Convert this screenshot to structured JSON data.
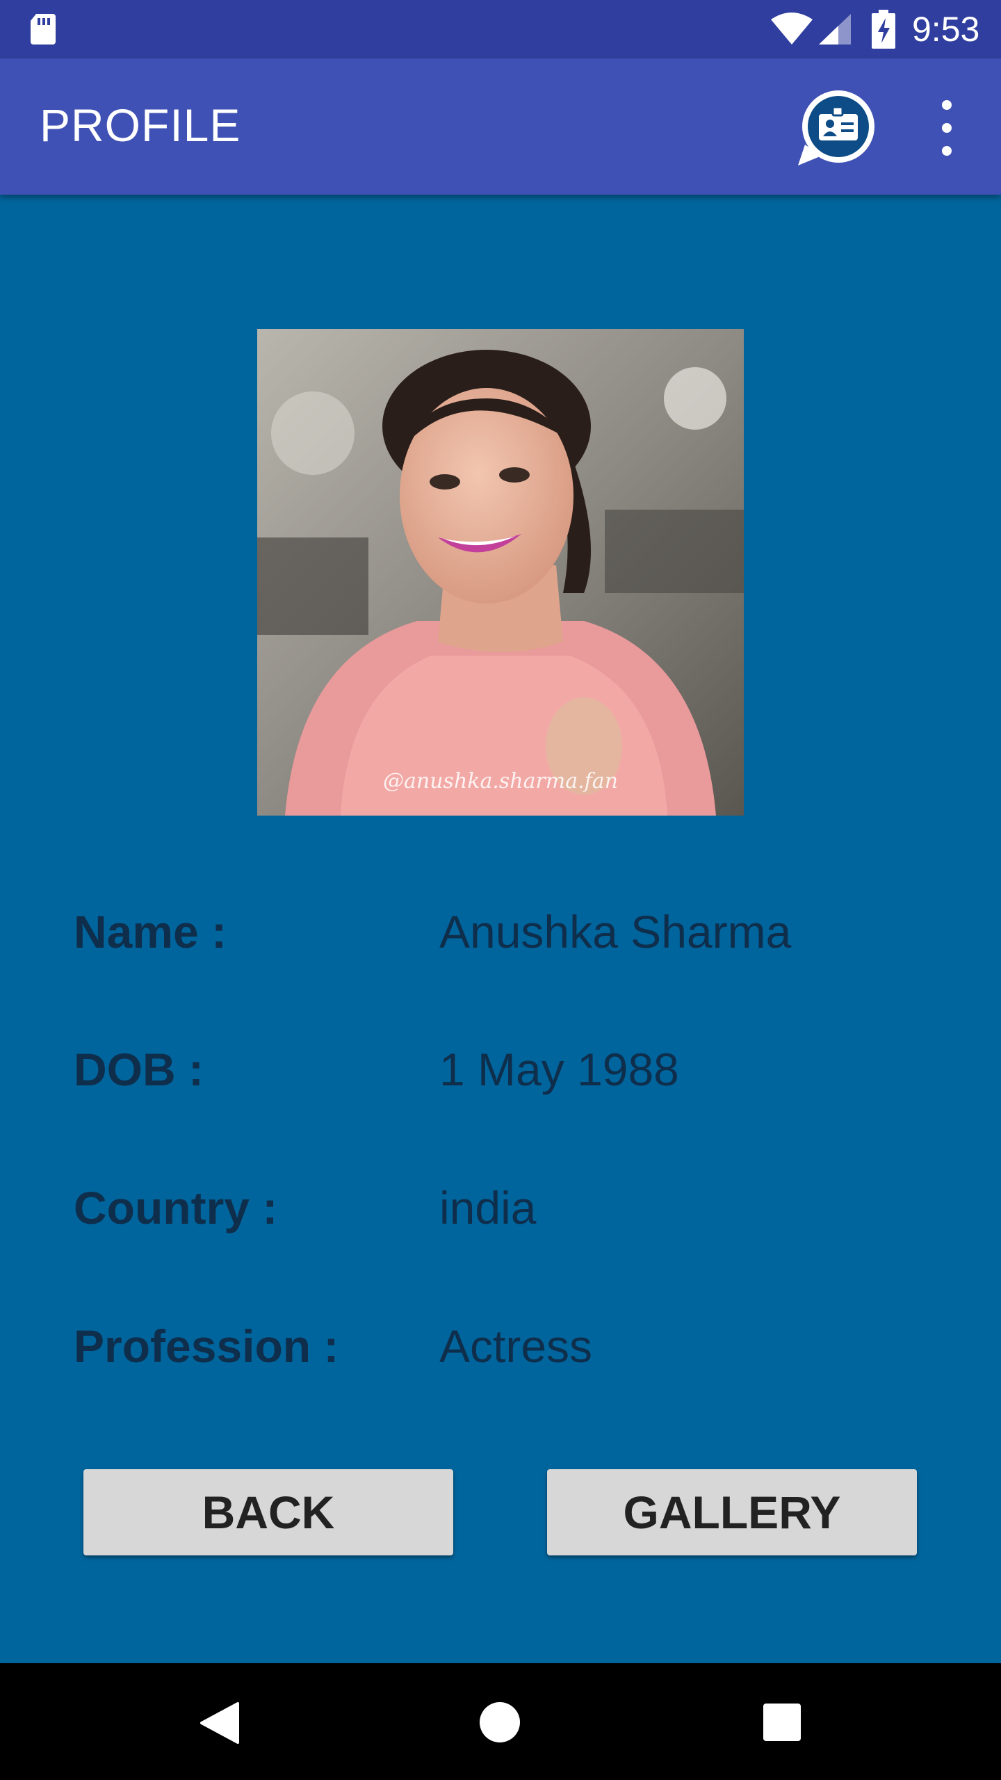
{
  "status_bar": {
    "time": "9:53",
    "icons": [
      "sd-card-icon",
      "wifi-icon",
      "cell-signal-icon",
      "battery-charging-icon"
    ]
  },
  "app_bar": {
    "title": "PROFILE",
    "actions": [
      "contact-card-icon",
      "overflow-menu-icon"
    ]
  },
  "profile": {
    "photo_caption": "@anushka.sharma.fan",
    "fields": [
      {
        "label": "Name :",
        "value": "Anushka Sharma"
      },
      {
        "label": "DOB :",
        "value": "1 May 1988"
      },
      {
        "label": "Country :",
        "value": "india"
      },
      {
        "label": "Profession :",
        "value": "Actress"
      }
    ]
  },
  "buttons": {
    "back": "BACK",
    "gallery": "GALLERY"
  },
  "nav_bar": {
    "icons": [
      "nav-back-icon",
      "nav-home-icon",
      "nav-recents-icon"
    ]
  },
  "colors": {
    "status_bar": "#303f9f",
    "app_bar": "#3f51b5",
    "background": "#01659d",
    "text": "#0e2e4c",
    "button": "#d7d7d7"
  }
}
